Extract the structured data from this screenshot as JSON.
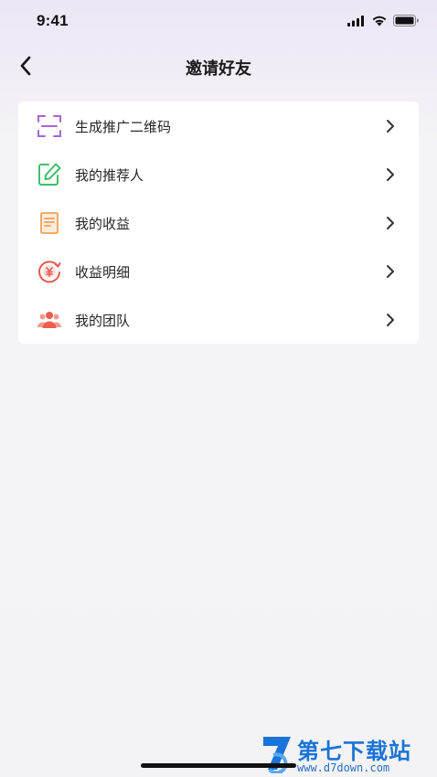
{
  "status_bar": {
    "time": "9:41"
  },
  "header": {
    "title": "邀请好友"
  },
  "menu": {
    "items": [
      {
        "label": "生成推广二维码",
        "icon": "qr-scan-icon",
        "color": "#a864d8"
      },
      {
        "label": "我的推荐人",
        "icon": "edit-icon",
        "color": "#3fbf6a"
      },
      {
        "label": "我的收益",
        "icon": "document-list-icon",
        "color": "#f0a05a"
      },
      {
        "label": "收益明细",
        "icon": "yuan-coin-icon",
        "color": "#e8584e"
      },
      {
        "label": "我的团队",
        "icon": "team-icon",
        "color": "#ea5f4f"
      }
    ]
  },
  "watermark": {
    "name": "第七下载站",
    "url": "www.d7down.com"
  }
}
